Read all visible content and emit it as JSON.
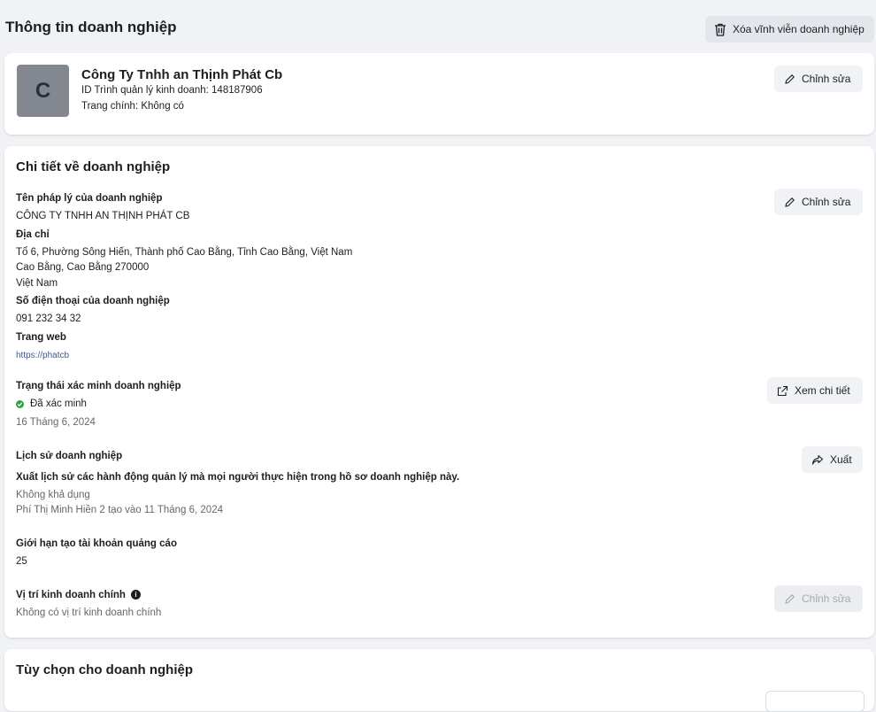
{
  "header": {
    "title": "Thông tin doanh nghiệp",
    "delete_label": "Xóa vĩnh viễn doanh nghiệp"
  },
  "profile": {
    "avatar_letter": "C",
    "name": "Công Ty Tnhh an Thịnh Phát Cb",
    "id_text": "ID Trình quản lý kinh doanh: 148187906",
    "page_text": "Trang chính: Không có",
    "edit_label": "Chỉnh sửa"
  },
  "details": {
    "title": "Chi tiết về doanh nghiệp",
    "legal_name_label": "Tên pháp lý của doanh nghiệp",
    "legal_name": "CÔNG TY TNHH AN THỊNH PHÁT CB",
    "edit_label": "Chỉnh sửa",
    "address_label": "Địa chỉ",
    "address_line1": "Tổ 6, Phường Sông Hiến, Thành phố Cao Bằng, Tỉnh Cao Bằng, Việt Nam",
    "address_line2": "Cao Bằng, Cao Bằng 270000",
    "address_line3": "Việt Nam",
    "phone_label": "Số điện thoại của doanh nghiệp",
    "phone": "091 232 34 32",
    "website_label": "Trang web",
    "website": "https://phatcb",
    "verification_label": "Trạng thái xác minh doanh nghiệp",
    "verification_status": "Đã xác minh",
    "verification_date": "16 Tháng 6, 2024",
    "view_details_label": "Xem chi tiết",
    "history_label": "Lịch sử doanh nghiệp",
    "history_desc": "Xuất lịch sử các hành động quản lý mà mọi người thực hiện trong hồ sơ doanh nghiệp này.",
    "history_status": "Không khả dụng",
    "history_created": "Phí Thị Minh Hiền 2 tạo vào 11 Tháng 6, 2024",
    "export_label": "Xuất",
    "ad_limit_label": "Giới hạn tạo tài khoản quảng cáo",
    "ad_limit": "25",
    "location_label": "Vị trí kinh doanh chính",
    "location_value": "Không có vị trí kinh doanh chính",
    "location_edit_label": "Chỉnh sửa"
  },
  "options": {
    "title": "Tùy chọn cho doanh nghiệp"
  }
}
